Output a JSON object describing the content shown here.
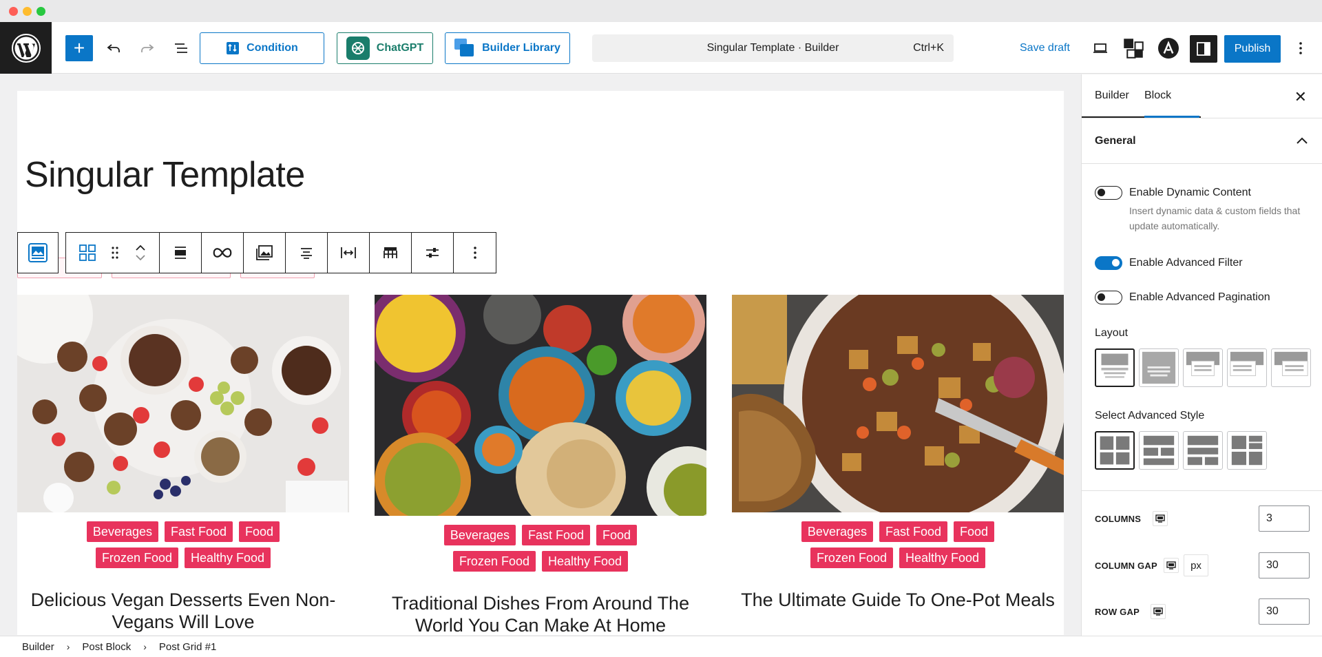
{
  "toolbar": {
    "condition_label": "Condition",
    "chatgpt_label": "ChatGPT",
    "library_label": "Builder Library",
    "command_title": "Singular Template · Builder",
    "command_shortcut": "Ctrl+K",
    "save_draft_label": "Save draft",
    "publish_label": "Publish"
  },
  "page": {
    "title": "Singular Template"
  },
  "posts": [
    {
      "tags": [
        "Beverages",
        "Fast Food",
        "Food",
        "Frozen Food",
        "Healthy Food"
      ],
      "title": "Delicious Vegan Desserts Even Non-Vegans Will Love"
    },
    {
      "tags": [
        "Beverages",
        "Fast Food",
        "Food",
        "Frozen Food",
        "Healthy Food"
      ],
      "title": "Traditional Dishes From Around The World You Can Make At Home"
    },
    {
      "tags": [
        "Beverages",
        "Fast Food",
        "Food",
        "Frozen Food",
        "Healthy Food"
      ],
      "title": "The Ultimate Guide To One-Pot Meals"
    }
  ],
  "sidebar": {
    "tabs": [
      "Builder",
      "Block"
    ],
    "active_tab": "Block",
    "section_title": "General",
    "toggles": [
      {
        "label": "Enable Dynamic Content",
        "help": "Insert dynamic data & custom fields that update automatically.",
        "on": false
      },
      {
        "label": "Enable Advanced Filter",
        "on": true
      },
      {
        "label": "Enable Advanced Pagination",
        "on": false
      }
    ],
    "layout_label": "Layout",
    "advanced_style_label": "Select Advanced Style",
    "columns_label": "COLUMNS",
    "columns_value": "3",
    "column_gap_label": "COLUMN GAP",
    "column_gap_unit": "px",
    "column_gap_value": "30",
    "row_gap_label": "ROW GAP",
    "row_gap_value": "30"
  },
  "breadcrumb": [
    "Builder",
    "Post Block",
    "Post Grid #1"
  ],
  "colors": {
    "accent": "#0a76c7",
    "tag": "#e8335d",
    "chatgpt": "#1a7d6b"
  }
}
